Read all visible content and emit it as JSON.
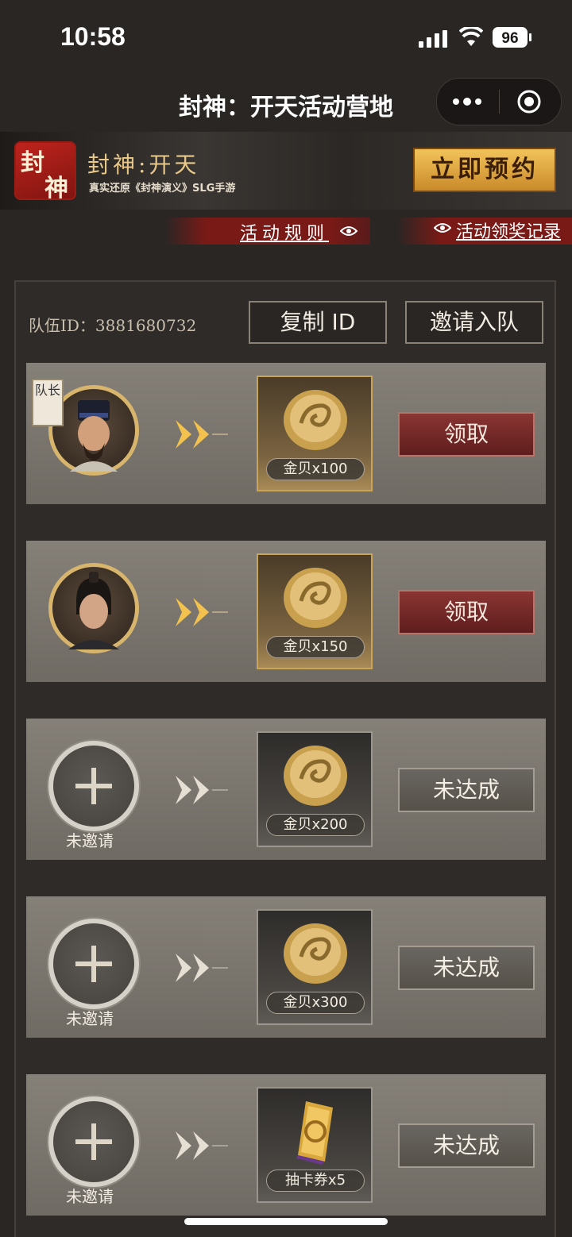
{
  "status": {
    "time": "10:58",
    "battery": "96"
  },
  "nav": {
    "title": "封神：开天活动营地"
  },
  "banner": {
    "logo_text_1": "封",
    "logo_text_2": "神",
    "title": "封神:开天",
    "subtitle": "真实还原《封神演义》SLG手游",
    "reserve_label": "立即预约"
  },
  "links": {
    "rules": "活动规则",
    "records": "活动领奖记录"
  },
  "team": {
    "id_label": "队伍ID：3881680732",
    "copy_label": "复制 ID",
    "invite_label": "邀请入队"
  },
  "rows": [
    {
      "captain": "队长",
      "reward": "金贝x100",
      "action": "领取"
    },
    {
      "reward": "金贝x150",
      "action": "领取"
    },
    {
      "status": "未邀请",
      "reward": "金贝x200",
      "action": "未达成"
    },
    {
      "status": "未邀请",
      "reward": "金贝x300",
      "action": "未达成"
    },
    {
      "status": "未邀请",
      "reward": "抽卡券x5",
      "action": "未达成"
    }
  ],
  "colors": {
    "claim": "#7a2b29",
    "pending": "#5f5b55",
    "gold_border": "#c9a55c"
  }
}
